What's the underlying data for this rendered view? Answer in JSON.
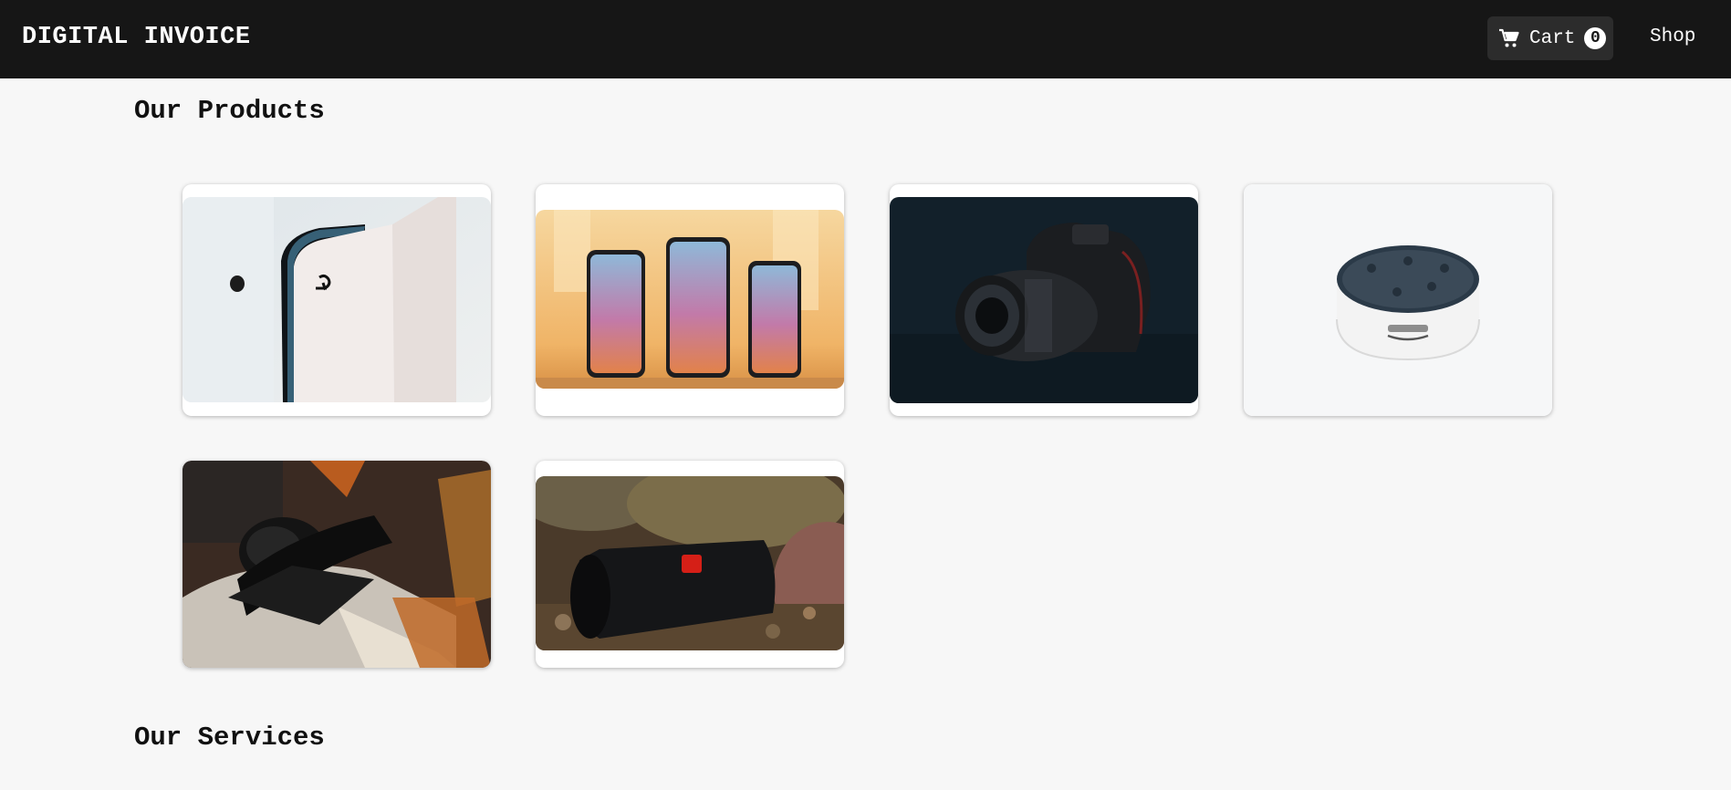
{
  "header": {
    "brand": "DIGITAL INVOICE",
    "cart_label": "Cart",
    "cart_count": "0",
    "cart_icon": "shopping-cart-icon",
    "shop_label": "Shop"
  },
  "sections": {
    "products_title": "Our Products",
    "services_title": "Our Services"
  },
  "products": [
    {
      "image": "playstation-5-console"
    },
    {
      "image": "three-iphones"
    },
    {
      "image": "canon-dslr-camera"
    },
    {
      "image": "amazon-echo-dot"
    },
    {
      "image": "audio-technica-headphones"
    },
    {
      "image": "jbl-bluetooth-speaker"
    }
  ],
  "colors": {
    "navbar": "#161616",
    "cart_button": "#2c2c2c",
    "page_background": "#f7f7f7",
    "card_background": "#ffffff"
  }
}
